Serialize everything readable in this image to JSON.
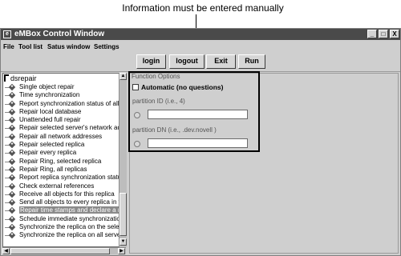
{
  "callout": {
    "text": "Information must be entered manually"
  },
  "window": {
    "title": "eMBox Control Window",
    "controls": {
      "minimize": "_",
      "maximize": "□",
      "close": "X"
    }
  },
  "menu": [
    "File",
    "Tool list",
    "Satus window",
    "Settings"
  ],
  "toolbar": {
    "login": "login",
    "logout": "logout",
    "exit": "Exit",
    "run": "Run"
  },
  "tree": {
    "root": "dsrepair",
    "items": [
      "Single object repair",
      "Time synchronization",
      "Report synchronization status of all p",
      "Repair local database",
      "Unattended full repair",
      "Repair selected server's network add",
      "Repair all network addresses",
      "Repair selected replica",
      "Repair every replica",
      "Repair Ring, selected replica",
      "Repair Ring, all replicas",
      "Report replica synchronization status",
      "Check external references",
      "Receive all objects for this replica",
      "Send all objects to every replica in th",
      "Repair time stamps and declare a ne",
      "Schedule immediate synchronization",
      "Synchronize the replica on the select",
      "Synchronize the replica on all servers"
    ],
    "selected_index": 15
  },
  "function_options": {
    "title": "Function Options",
    "automatic_label": "Automatic (no questions)",
    "partition_id_label": "partition ID (i.e., 4)",
    "partition_id_value": "",
    "partition_dn_label": "partition DN (i.e., .dev.novell )",
    "partition_dn_value": ""
  },
  "icons": {
    "app": "embox-app-icon",
    "root": "tree-root-icon",
    "item": "tool-diamond-icon",
    "scroll_up": "scroll-up-arrow-icon",
    "scroll_down": "scroll-down-arrow-icon",
    "scroll_left": "scroll-left-arrow-icon",
    "scroll_right": "scroll-right-arrow-icon"
  }
}
